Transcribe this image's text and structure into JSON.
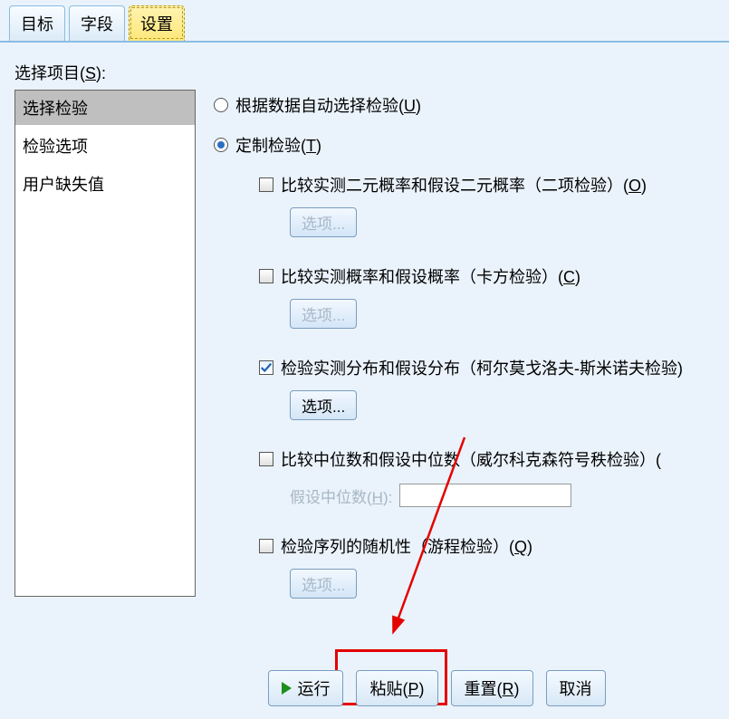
{
  "tabs": {
    "items": [
      {
        "label": "目标",
        "active": false
      },
      {
        "label": "字段",
        "active": false
      },
      {
        "label": "设置",
        "active": true
      }
    ]
  },
  "left": {
    "title": "选择项目(S):",
    "title_underline": "S",
    "items": [
      {
        "label": "选择检验",
        "selected": true
      },
      {
        "label": "检验选项",
        "selected": false
      },
      {
        "label": "用户缺失值",
        "selected": false
      }
    ]
  },
  "radios": {
    "auto": {
      "label": "根据数据自动选择检验(U)",
      "ul": "U",
      "checked": false
    },
    "custom": {
      "label": "定制检验(T)",
      "ul": "T",
      "checked": true
    }
  },
  "checks": {
    "binom": {
      "label": "比较实测二元概率和假设二元概率（二项检验）(O)",
      "ul": "O",
      "checked": false,
      "options_label": "选项...",
      "options_enabled": false
    },
    "chisq": {
      "label": "比较实测概率和假设概率（卡方检验）(C)",
      "ul": "C",
      "checked": false,
      "options_label": "选项...",
      "options_enabled": false
    },
    "ks": {
      "label": "检验实测分布和假设分布（柯尔莫戈洛夫-斯米诺夫检验)",
      "checked": true,
      "options_label": "选项...",
      "options_enabled": true
    },
    "wilcoxon": {
      "label": "比较中位数和假设中位数（威尔科克森符号秩检验）(",
      "checked": false,
      "hyp_label": "假设中位数(H):",
      "hyp_ul": "H",
      "hyp_value": ""
    },
    "runs": {
      "label": "检验序列的随机性（游程检验）(Q)",
      "ul": "Q",
      "checked": false,
      "options_label": "选项...",
      "options_enabled": false
    }
  },
  "buttons": {
    "run": "运行",
    "paste": "粘贴(P)",
    "reset": "重置(R)",
    "cancel": "取消"
  },
  "paste_ul": "P",
  "reset_ul": "R"
}
